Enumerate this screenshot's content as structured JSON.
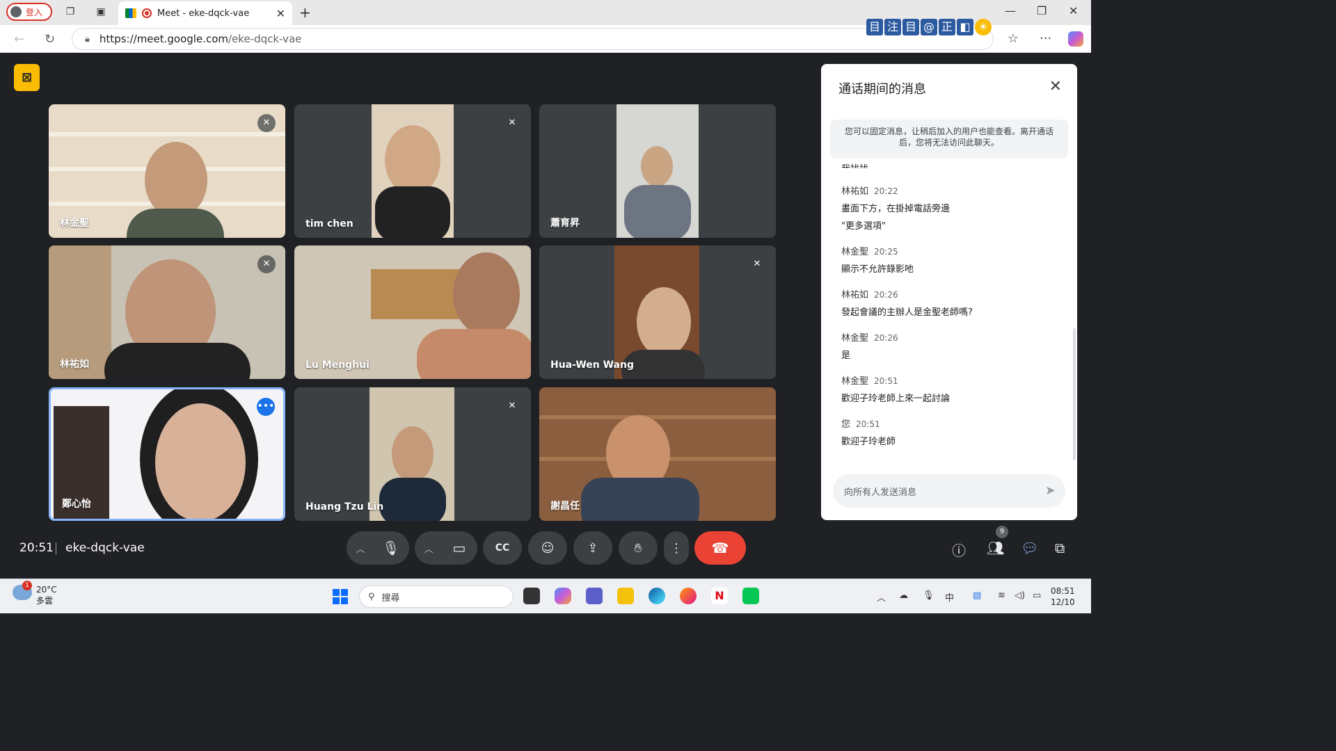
{
  "browser": {
    "profile_label": "登入",
    "tab_title": "Meet - eke-dqck-vae",
    "url_host": "https://meet.google.com",
    "url_path": "/eke-dqck-vae",
    "extensions": [
      "目",
      "注",
      "目",
      "@",
      "正",
      "◧"
    ]
  },
  "meeting": {
    "time": "20:51",
    "code": "eke-dqck-vae",
    "participant_count": "9",
    "participants": [
      {
        "name": "林金聖",
        "muted": true
      },
      {
        "name": "tim chen",
        "muted": true
      },
      {
        "name": "蕭育昇",
        "muted": false
      },
      {
        "name": "林祐如",
        "muted": true
      },
      {
        "name": "Lu Menghui",
        "muted": false
      },
      {
        "name": "Hua-Wen Wang",
        "muted": true
      },
      {
        "name": "鄭心怡",
        "muted": false,
        "active": true
      },
      {
        "name": "Huang Tzu Lin",
        "muted": true
      },
      {
        "name": "謝昌任",
        "muted": false
      }
    ]
  },
  "chat": {
    "title": "通话期间的消息",
    "notice": "您可以固定消息，让稍后加入的用户也能查看。离开通话后，您将无法访问此聊天。",
    "partial_line": "我找找",
    "messages": [
      {
        "sender": "林祐如",
        "time": "20:22",
        "lines": [
          "畫面下方，在掛掉電話旁邊",
          "\"更多選項\""
        ]
      },
      {
        "sender": "林金聖",
        "time": "20:25",
        "lines": [
          "顯示不允許錄影吔"
        ]
      },
      {
        "sender": "林祐如",
        "time": "20:26",
        "lines": [
          "發起會議的主辦人是金聖老師嗎?"
        ]
      },
      {
        "sender": "林金聖",
        "time": "20:26",
        "lines": [
          "是"
        ]
      },
      {
        "sender": "林金聖",
        "time": "20:51",
        "lines": [
          "歡迎子玲老師上來一起討論"
        ]
      },
      {
        "sender": "您",
        "time": "20:51",
        "lines": [
          "歡迎子玲老師"
        ]
      }
    ],
    "input_placeholder": "向所有人发送消息"
  },
  "taskbar": {
    "weather_temp": "20°C",
    "weather_desc": "多雲",
    "weather_badge": "1",
    "search_placeholder": "搜尋",
    "clock_time": "08:51",
    "clock_date": "12/10",
    "ime_label": "中"
  }
}
